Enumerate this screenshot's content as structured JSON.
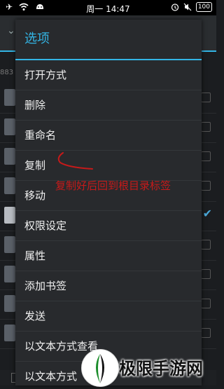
{
  "status_bar": {
    "time": "周一 14:47",
    "battery": "100",
    "left_icons": [
      "airplane-icon",
      "wifi-icon",
      "android-icon"
    ],
    "right_icons": [
      "alarm-icon",
      "mute-icon"
    ]
  },
  "background": {
    "path_fragment": "883"
  },
  "dialog": {
    "title": "选项",
    "items": [
      {
        "label": "打开方式"
      },
      {
        "label": "删除"
      },
      {
        "label": "重命名"
      },
      {
        "label": "复制"
      },
      {
        "label": "移动"
      },
      {
        "label": "权限设定"
      },
      {
        "label": "属性"
      },
      {
        "label": "添加书签"
      },
      {
        "label": "发送"
      },
      {
        "label": "以文本方式查看"
      },
      {
        "label": "以文本方式"
      }
    ]
  },
  "annotation": {
    "text": "复制好后回到根目录标签",
    "color": "#c61a1a"
  },
  "watermark": {
    "text": "极限手游网"
  },
  "colors": {
    "accent": "#33b5e5",
    "dialog_bg": "#282a2d"
  }
}
